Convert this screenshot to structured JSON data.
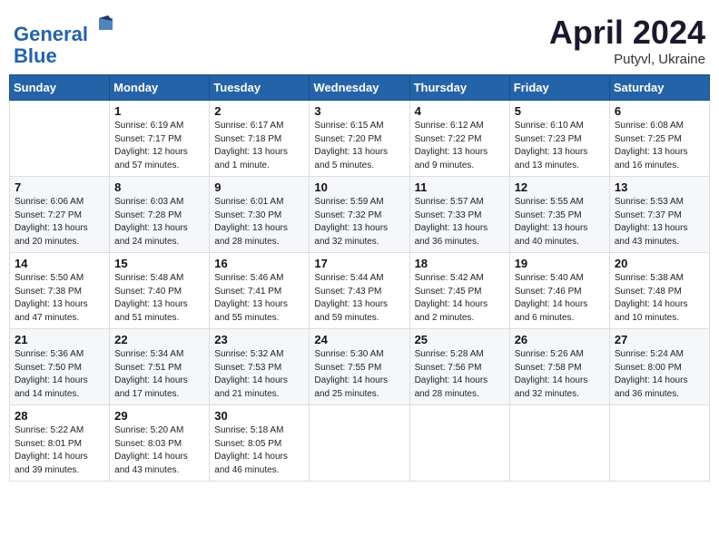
{
  "header": {
    "logo_line1": "General",
    "logo_line2": "Blue",
    "month_title": "April 2024",
    "subtitle": "Putyvl, Ukraine"
  },
  "days_of_week": [
    "Sunday",
    "Monday",
    "Tuesday",
    "Wednesday",
    "Thursday",
    "Friday",
    "Saturday"
  ],
  "weeks": [
    [
      {
        "day": "",
        "info": ""
      },
      {
        "day": "1",
        "info": "Sunrise: 6:19 AM\nSunset: 7:17 PM\nDaylight: 12 hours\nand 57 minutes."
      },
      {
        "day": "2",
        "info": "Sunrise: 6:17 AM\nSunset: 7:18 PM\nDaylight: 13 hours\nand 1 minute."
      },
      {
        "day": "3",
        "info": "Sunrise: 6:15 AM\nSunset: 7:20 PM\nDaylight: 13 hours\nand 5 minutes."
      },
      {
        "day": "4",
        "info": "Sunrise: 6:12 AM\nSunset: 7:22 PM\nDaylight: 13 hours\nand 9 minutes."
      },
      {
        "day": "5",
        "info": "Sunrise: 6:10 AM\nSunset: 7:23 PM\nDaylight: 13 hours\nand 13 minutes."
      },
      {
        "day": "6",
        "info": "Sunrise: 6:08 AM\nSunset: 7:25 PM\nDaylight: 13 hours\nand 16 minutes."
      }
    ],
    [
      {
        "day": "7",
        "info": "Sunrise: 6:06 AM\nSunset: 7:27 PM\nDaylight: 13 hours\nand 20 minutes."
      },
      {
        "day": "8",
        "info": "Sunrise: 6:03 AM\nSunset: 7:28 PM\nDaylight: 13 hours\nand 24 minutes."
      },
      {
        "day": "9",
        "info": "Sunrise: 6:01 AM\nSunset: 7:30 PM\nDaylight: 13 hours\nand 28 minutes."
      },
      {
        "day": "10",
        "info": "Sunrise: 5:59 AM\nSunset: 7:32 PM\nDaylight: 13 hours\nand 32 minutes."
      },
      {
        "day": "11",
        "info": "Sunrise: 5:57 AM\nSunset: 7:33 PM\nDaylight: 13 hours\nand 36 minutes."
      },
      {
        "day": "12",
        "info": "Sunrise: 5:55 AM\nSunset: 7:35 PM\nDaylight: 13 hours\nand 40 minutes."
      },
      {
        "day": "13",
        "info": "Sunrise: 5:53 AM\nSunset: 7:37 PM\nDaylight: 13 hours\nand 43 minutes."
      }
    ],
    [
      {
        "day": "14",
        "info": "Sunrise: 5:50 AM\nSunset: 7:38 PM\nDaylight: 13 hours\nand 47 minutes."
      },
      {
        "day": "15",
        "info": "Sunrise: 5:48 AM\nSunset: 7:40 PM\nDaylight: 13 hours\nand 51 minutes."
      },
      {
        "day": "16",
        "info": "Sunrise: 5:46 AM\nSunset: 7:41 PM\nDaylight: 13 hours\nand 55 minutes."
      },
      {
        "day": "17",
        "info": "Sunrise: 5:44 AM\nSunset: 7:43 PM\nDaylight: 13 hours\nand 59 minutes."
      },
      {
        "day": "18",
        "info": "Sunrise: 5:42 AM\nSunset: 7:45 PM\nDaylight: 14 hours\nand 2 minutes."
      },
      {
        "day": "19",
        "info": "Sunrise: 5:40 AM\nSunset: 7:46 PM\nDaylight: 14 hours\nand 6 minutes."
      },
      {
        "day": "20",
        "info": "Sunrise: 5:38 AM\nSunset: 7:48 PM\nDaylight: 14 hours\nand 10 minutes."
      }
    ],
    [
      {
        "day": "21",
        "info": "Sunrise: 5:36 AM\nSunset: 7:50 PM\nDaylight: 14 hours\nand 14 minutes."
      },
      {
        "day": "22",
        "info": "Sunrise: 5:34 AM\nSunset: 7:51 PM\nDaylight: 14 hours\nand 17 minutes."
      },
      {
        "day": "23",
        "info": "Sunrise: 5:32 AM\nSunset: 7:53 PM\nDaylight: 14 hours\nand 21 minutes."
      },
      {
        "day": "24",
        "info": "Sunrise: 5:30 AM\nSunset: 7:55 PM\nDaylight: 14 hours\nand 25 minutes."
      },
      {
        "day": "25",
        "info": "Sunrise: 5:28 AM\nSunset: 7:56 PM\nDaylight: 14 hours\nand 28 minutes."
      },
      {
        "day": "26",
        "info": "Sunrise: 5:26 AM\nSunset: 7:58 PM\nDaylight: 14 hours\nand 32 minutes."
      },
      {
        "day": "27",
        "info": "Sunrise: 5:24 AM\nSunset: 8:00 PM\nDaylight: 14 hours\nand 36 minutes."
      }
    ],
    [
      {
        "day": "28",
        "info": "Sunrise: 5:22 AM\nSunset: 8:01 PM\nDaylight: 14 hours\nand 39 minutes."
      },
      {
        "day": "29",
        "info": "Sunrise: 5:20 AM\nSunset: 8:03 PM\nDaylight: 14 hours\nand 43 minutes."
      },
      {
        "day": "30",
        "info": "Sunrise: 5:18 AM\nSunset: 8:05 PM\nDaylight: 14 hours\nand 46 minutes."
      },
      {
        "day": "",
        "info": ""
      },
      {
        "day": "",
        "info": ""
      },
      {
        "day": "",
        "info": ""
      },
      {
        "day": "",
        "info": ""
      }
    ]
  ]
}
